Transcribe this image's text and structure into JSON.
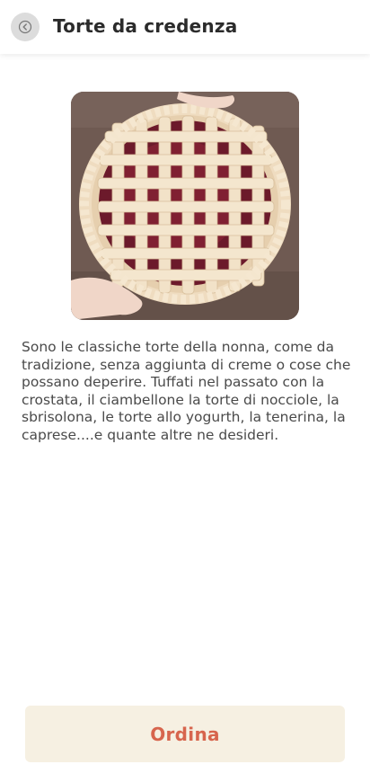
{
  "header": {
    "title": "Torte da credenza",
    "back_icon": "back-arrow-icon"
  },
  "hero": {
    "image_subject": "lattice pie crust with berries held by hands"
  },
  "main": {
    "description": "Sono le classiche torte della nonna, come da tradizione, senza aggiunta di creme o cose che possano deperire. Tuffati nel passato con la crostata, il ciambellone la torte di nocciole, la sbrisolona, le torte allo yogurth, la tenerina, la caprese....e quante altre ne desideri."
  },
  "footer": {
    "order_label": "Ordina"
  },
  "colors": {
    "accent": "#d7654d",
    "button_bg": "#f6f0e2",
    "back_bg": "#dcdcdc"
  }
}
